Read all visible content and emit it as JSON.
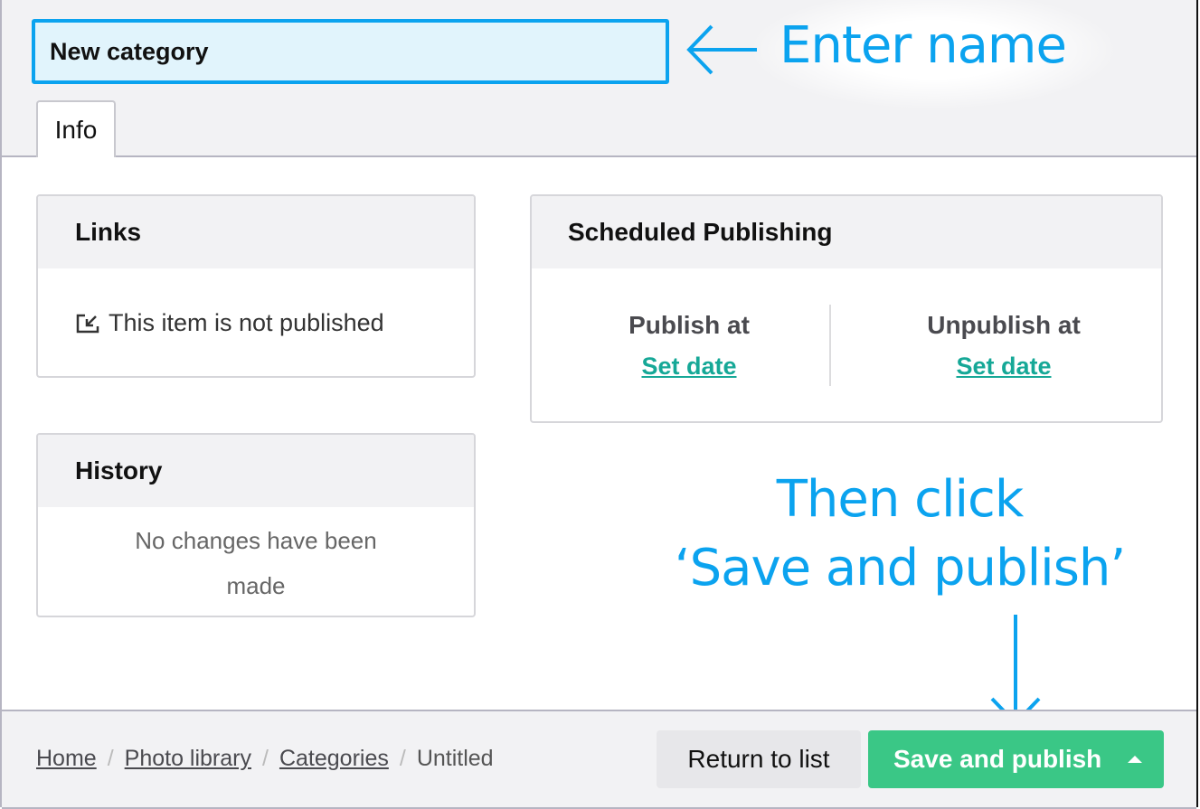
{
  "header": {
    "name_input": {
      "value": "New category",
      "placeholder": ""
    },
    "tabs": [
      {
        "label": "Info",
        "active": true
      }
    ]
  },
  "annotations": {
    "enter_name": "Enter name",
    "then_click_line1": "Then click",
    "then_click_line2": "‘Save and publish’",
    "color": "#0ba3ef"
  },
  "links_card": {
    "title": "Links",
    "status_icon": "unpublished-icon",
    "status_text": "This item is not published"
  },
  "history_card": {
    "title": "History",
    "empty_text": "No changes have been made"
  },
  "scheduled_card": {
    "title": "Scheduled Publishing",
    "publish_label": "Publish at",
    "publish_link": "Set date",
    "unpublish_label": "Unpublish at",
    "unpublish_link": "Set date"
  },
  "footer": {
    "breadcrumbs": [
      {
        "label": "Home",
        "link": true
      },
      {
        "label": "Photo library",
        "link": true
      },
      {
        "label": "Categories",
        "link": true
      },
      {
        "label": "Untitled",
        "link": false
      }
    ],
    "separator": "/",
    "return_button": "Return to list",
    "save_button": "Save and publish",
    "save_menu_icon": "caret-up-icon"
  },
  "colors": {
    "accent_blue": "#0ba3ef",
    "save_green": "#3ac786",
    "link_teal": "#16a897"
  }
}
